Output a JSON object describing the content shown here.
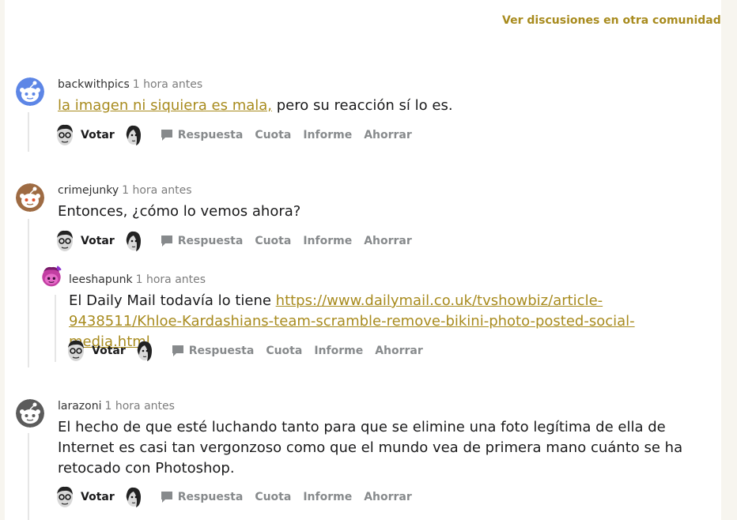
{
  "header": {
    "link_label": "Ver discusiones en otra comunidad"
  },
  "comments": [
    {
      "user": "backwithpics",
      "time": "1 hora antes",
      "link_text": "la imagen ni siquiera es mala,",
      "text": " pero su reacción sí lo es.",
      "avatar_icon": "snoo-blue-avatar-icon"
    },
    {
      "user": "crimejunky",
      "time": "1 hora antes",
      "text": "Entonces, ¿cómo lo vemos ahora?",
      "avatar_icon": "snoo-brown-avatar-icon"
    },
    {
      "user": "leeshapunk",
      "time": "1 hora antes",
      "text": "El Daily Mail todavía lo tiene ",
      "link_text": "https://www.dailymail.co.uk/tvshowbiz/article-9438511/Khloe-Kardashians-team-scramble-remove-bikini-photo-posted-social-media.html",
      "avatar_icon": "snoo-pink-avatar-icon"
    },
    {
      "user": "larazoni",
      "time": "1 hora antes",
      "text": "El hecho de que esté luchando tanto para que se elimine una foto legítima de ella de Internet es casi tan vergonzoso como que el mundo vea de primera mano cuánto se ha retocado con Photoshop.",
      "avatar_icon": "snoo-gray-avatar-icon"
    }
  ],
  "actions": {
    "vote": "Votar",
    "reply": "Respuesta",
    "share": "Cuota",
    "report": "Informe",
    "save": "Ahorrar",
    "upvote_icon": "upvote-face-icon",
    "downvote_icon": "downvote-face-icon",
    "reply_icon": "comment-bubble-icon"
  },
  "colors": {
    "link": "#a88b1e",
    "action_gray": "#878a8c",
    "meta_gray": "#7c7c7c"
  }
}
